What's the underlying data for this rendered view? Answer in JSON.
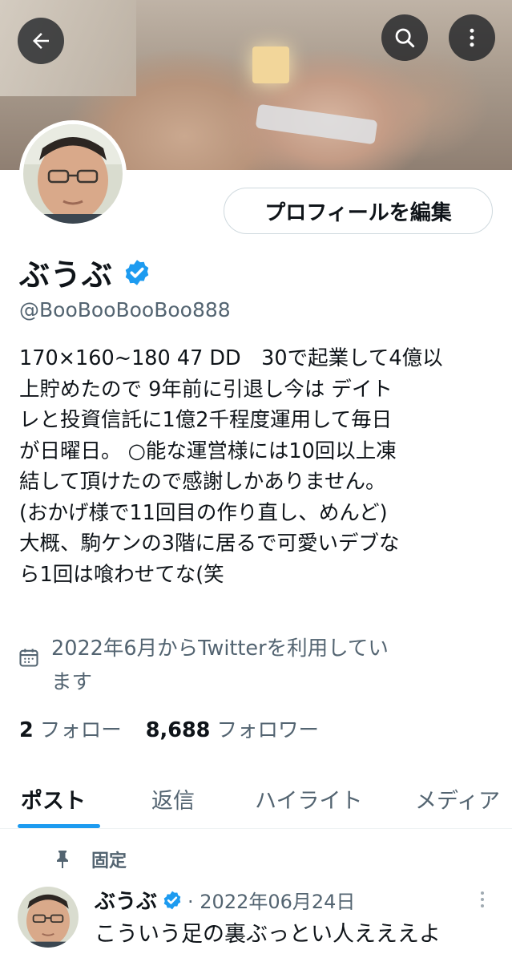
{
  "header": {
    "back_icon": "arrow-left-icon",
    "search_icon": "search-icon",
    "more_icon": "more-vertical-icon"
  },
  "profile": {
    "edit_button_label": "プロフィールを編集",
    "display_name": "ぶうぶ",
    "handle": "@BooBooBooBoo888",
    "bio_lines": [
      "170×160~180 47 DD　30で起業して4億以",
      "上貯めたので 9年前に引退し今は デイト",
      "レと投資信託に1億2千程度運用して毎日",
      "が日曜日。 ○能な運営様には10回以上凍",
      "結して頂けたので感謝しかありません。",
      "(おかげ様で11回目の作り直し、めんど)",
      "大概、駒ケンの3階に居るで可愛いデブな",
      "ら1回は喰わせてな(笑"
    ],
    "joined_lines": [
      "2022年6月からTwitterを利用してい",
      "ます"
    ],
    "following_count": "2",
    "following_label": "フォロー",
    "followers_count": "8,688",
    "followers_label": "フォロワー"
  },
  "tabs": [
    {
      "label": "ポスト",
      "active": true
    },
    {
      "label": "返信",
      "active": false
    },
    {
      "label": "ハイライト",
      "active": false
    },
    {
      "label": "メディア",
      "active": false
    }
  ],
  "pinned_tweet": {
    "pinned_label": "固定",
    "author_name": "ぶうぶ",
    "date": "· 2022年06月24日",
    "text": "こういう足の裏ぶっとい人えええよ"
  },
  "colors": {
    "accent": "#1d9bf0",
    "secondary_text": "#536471",
    "primary_text": "#0f1419",
    "border": "#cfd9de"
  }
}
